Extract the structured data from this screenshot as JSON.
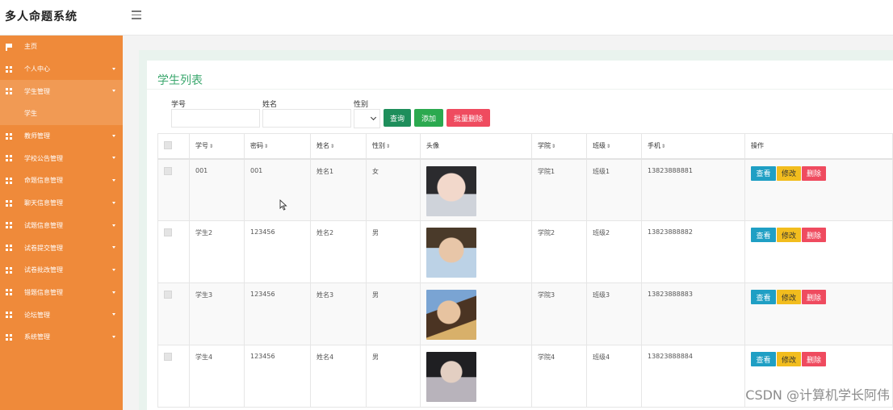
{
  "app": {
    "title": "多人命题系统"
  },
  "sidebar": {
    "items": [
      {
        "label": "主页",
        "icon": "flag-icon"
      },
      {
        "label": "个人中心",
        "icon": "grid-icon"
      },
      {
        "label": "学生管理",
        "icon": "grid-icon",
        "expanded": true
      },
      {
        "label": "学生",
        "sub": true
      },
      {
        "label": "教师管理",
        "icon": "grid-icon"
      },
      {
        "label": "学校公告管理",
        "icon": "grid-icon"
      },
      {
        "label": "命题信息管理",
        "icon": "grid-icon"
      },
      {
        "label": "聊天信息管理",
        "icon": "grid-icon"
      },
      {
        "label": "试题信息管理",
        "icon": "grid-icon"
      },
      {
        "label": "试卷提交管理",
        "icon": "grid-icon"
      },
      {
        "label": "试卷批改管理",
        "icon": "grid-icon"
      },
      {
        "label": "错题信息管理",
        "icon": "grid-icon"
      },
      {
        "label": "论坛管理",
        "icon": "grid-icon"
      },
      {
        "label": "系统管理",
        "icon": "grid-icon"
      }
    ]
  },
  "page": {
    "title": "学生列表",
    "filters": {
      "student_no_label": "学号",
      "name_label": "姓名",
      "gender_label": "性别"
    },
    "buttons": {
      "search": "查询",
      "add": "添加",
      "batch_delete": "批量删除"
    }
  },
  "table": {
    "headers": [
      "学号",
      "密码",
      "姓名",
      "性别",
      "头像",
      "学院",
      "班级",
      "手机",
      "操作"
    ],
    "actions": {
      "view": "查看",
      "edit": "修改",
      "delete": "删除"
    },
    "rows": [
      {
        "student_no": "001",
        "password": "001",
        "name": "姓名1",
        "gender": "女",
        "college": "学院1",
        "class": "班级1",
        "phone": "13823888881"
      },
      {
        "student_no": "学生2",
        "password": "123456",
        "name": "姓名2",
        "gender": "男",
        "college": "学院2",
        "class": "班级2",
        "phone": "13823888882"
      },
      {
        "student_no": "学生3",
        "password": "123456",
        "name": "姓名3",
        "gender": "男",
        "college": "学院3",
        "class": "班级3",
        "phone": "13823888883"
      },
      {
        "student_no": "学生4",
        "password": "123456",
        "name": "姓名4",
        "gender": "男",
        "college": "学院4",
        "class": "班级4",
        "phone": "13823888884"
      }
    ]
  },
  "watermark": "CSDN @计算机学长阿伟",
  "colors": {
    "sidebar": "#ef8a3a",
    "accent": "#3aa76d",
    "view": "#1f9fc4",
    "edit": "#f2bd1e",
    "delete": "#ef4b5f"
  }
}
